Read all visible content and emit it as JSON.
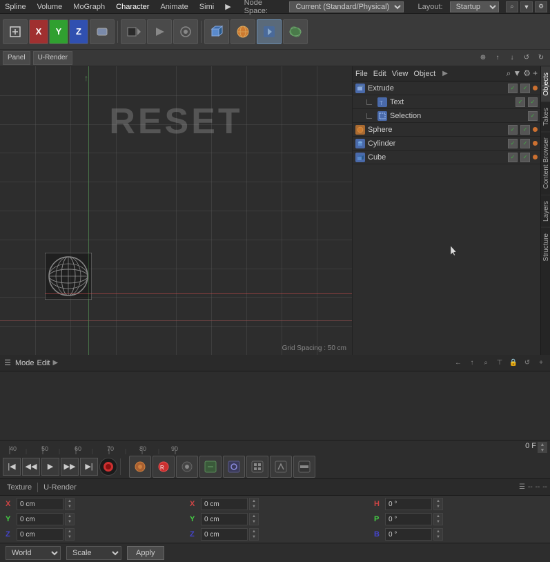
{
  "menubar": {
    "items": [
      "Spline",
      "Volume",
      "MoGraph",
      "Character",
      "Animate",
      "Simi",
      "▶"
    ],
    "nodespace_label": "Node Space:",
    "nodespace_value": "Current (Standard/Physical)",
    "layout_label": "Layout:",
    "layout_value": "Startup"
  },
  "toolbar": {
    "xyz": [
      "X",
      "Y",
      "Z"
    ]
  },
  "toolbar2": {
    "tabs": [
      "Panel",
      "U-Render"
    ]
  },
  "viewport": {
    "reset_text": "RESET",
    "grid_spacing": "Grid Spacing : 50 cm"
  },
  "objects_panel": {
    "file_label": "File",
    "edit_label": "Edit",
    "view_label": "View",
    "object_label": "Object",
    "items": [
      {
        "name": "Extrude",
        "indent": 0,
        "type": "blue"
      },
      {
        "name": "Text",
        "indent": 1,
        "type": "blue"
      },
      {
        "name": "Selection",
        "indent": 1,
        "type": "blue"
      },
      {
        "name": "Sphere",
        "indent": 0,
        "type": "orange"
      },
      {
        "name": "Cylinder",
        "indent": 0,
        "type": "blue"
      },
      {
        "name": "Cube",
        "indent": 0,
        "type": "blue"
      }
    ]
  },
  "vtabs": [
    "Objects",
    "Takes",
    "Content Browser",
    "Layers",
    "Structure"
  ],
  "mode_bar": {
    "mode": "Mode",
    "edit": "Edit"
  },
  "timeline": {
    "marks": [
      "40",
      "50",
      "60",
      "70",
      "80",
      "90"
    ],
    "frame": "0 F"
  },
  "playback": {
    "buttons": [
      "⏮",
      "⏪",
      "▶",
      "⏩",
      "⏭",
      "⏺"
    ]
  },
  "bottom": {
    "tabs_left": [
      "Texture",
      "U-Render"
    ],
    "coord_cols": [
      {
        "rows": [
          {
            "label": "X",
            "value": "0 cm"
          },
          {
            "label": "Y",
            "value": "0 cm"
          },
          {
            "label": "Z",
            "value": "0 cm"
          }
        ]
      },
      {
        "rows": [
          {
            "label": "X",
            "value": "0 cm"
          },
          {
            "label": "Y",
            "value": "0 cm"
          },
          {
            "label": "Z",
            "value": "0 cm"
          }
        ]
      },
      {
        "rows": [
          {
            "label": "H",
            "value": "0 °"
          },
          {
            "label": "P",
            "value": "0 °"
          },
          {
            "label": "B",
            "value": "0 °"
          }
        ]
      }
    ],
    "world_label": "World",
    "scale_label": "Scale",
    "apply_label": "Apply"
  }
}
